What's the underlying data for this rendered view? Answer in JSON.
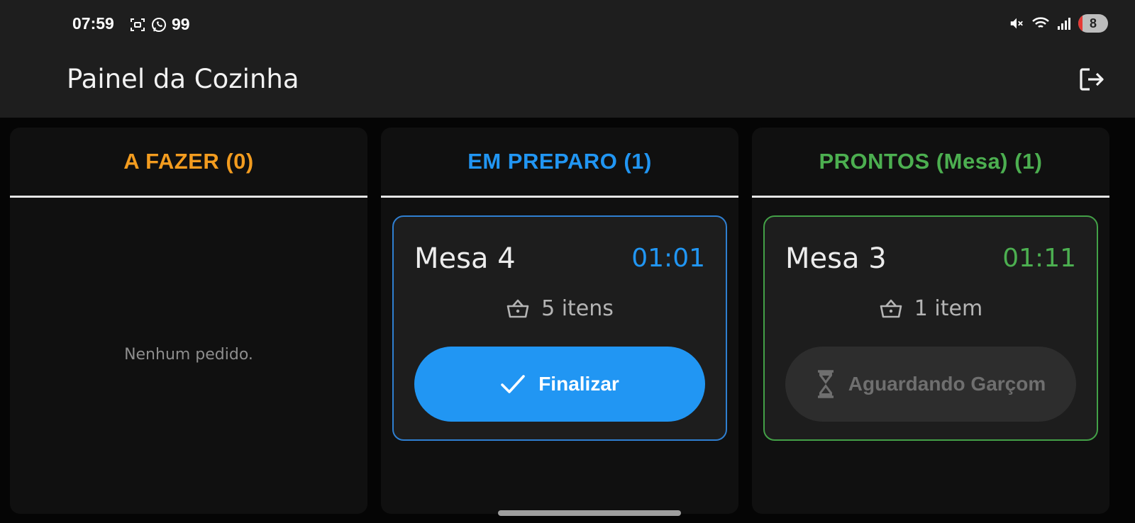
{
  "status_bar": {
    "time": "07:59",
    "notification_count": "99",
    "battery": "8"
  },
  "app_bar": {
    "title": "Painel da Cozinha"
  },
  "columns": [
    {
      "header": "A FAZER (0)",
      "color": "#f39c1f",
      "empty_message": "Nenhum pedido."
    },
    {
      "header": "EM PREPARO (1)",
      "color": "#2196f3",
      "card": {
        "title": "Mesa 4",
        "timer": "01:01",
        "items": "5 itens",
        "button_label": "Finalizar",
        "button_icon": "check-icon"
      }
    },
    {
      "header": "PRONTOS (Mesa) (1)",
      "color": "#4caf50",
      "card": {
        "title": "Mesa 3",
        "timer": "01:11",
        "items": "1 item",
        "button_label": "Aguardando Garçom",
        "button_icon": "hourglass-icon"
      }
    }
  ]
}
